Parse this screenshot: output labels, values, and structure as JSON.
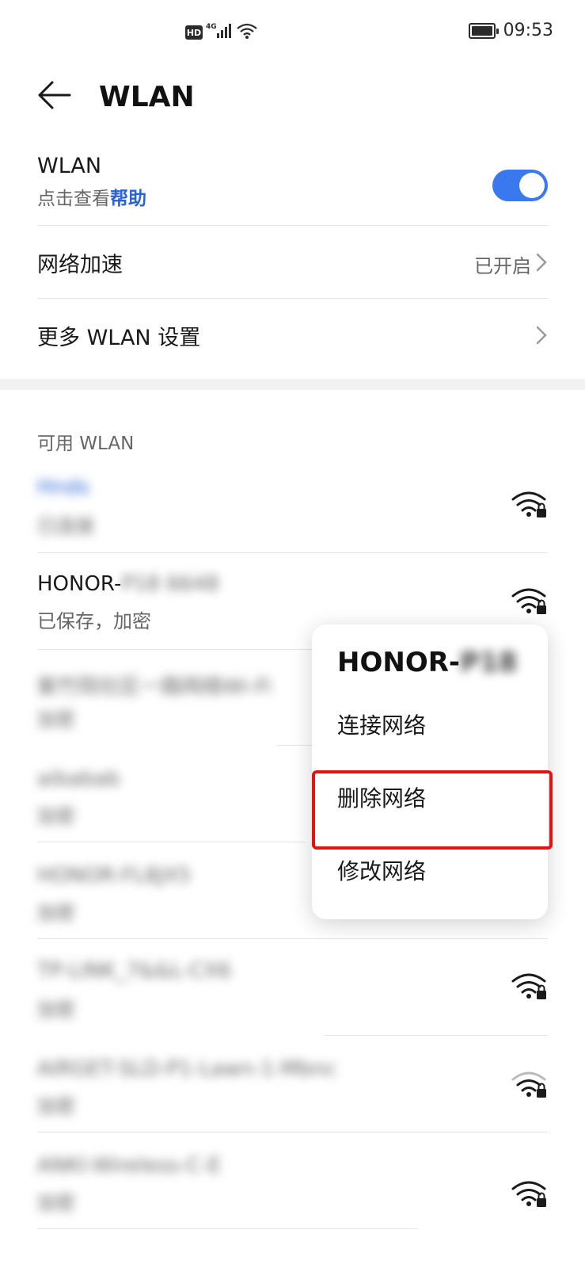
{
  "status_bar": {
    "hd": "HD",
    "network": "4G",
    "time": "09:53"
  },
  "header": {
    "title": "WLAN"
  },
  "settings": {
    "wlan_label": "WLAN",
    "wlan_hint_prefix": "点击查看",
    "wlan_hint_link": "帮助",
    "wlan_enabled": true,
    "accel_label": "网络加速",
    "accel_value": "已开启",
    "more_label": "更多 WLAN 设置"
  },
  "available": {
    "title": "可用 WLAN",
    "networks": [
      {
        "name": "Hnds",
        "status": "已连接"
      },
      {
        "name": "HONOR-",
        "name_blurred": "P18 6648",
        "status": "已保存，加密"
      },
      {
        "name": "紫竹院社区一路网络Wi-Fi",
        "status": "加密"
      },
      {
        "name": "aibabab",
        "status": "加密"
      },
      {
        "name": "HONOR-FL8JX5",
        "status": "加密"
      },
      {
        "name": "TP-LINK_7&&L-CX6",
        "status": "加密"
      },
      {
        "name": "AIRGET-SLD-P1-Lawn-1-Mbnc",
        "status": "加密"
      },
      {
        "name": "ANKI-Wireless-C-E",
        "status": "加密"
      }
    ]
  },
  "popup": {
    "title_prefix": "HONOR-",
    "title_blurred": "P18",
    "connect": "连接网络",
    "delete": "删除网络",
    "modify": "修改网络"
  },
  "colors": {
    "accent": "#3a78f0",
    "link": "#2a63d6",
    "highlight": "#e11414"
  }
}
